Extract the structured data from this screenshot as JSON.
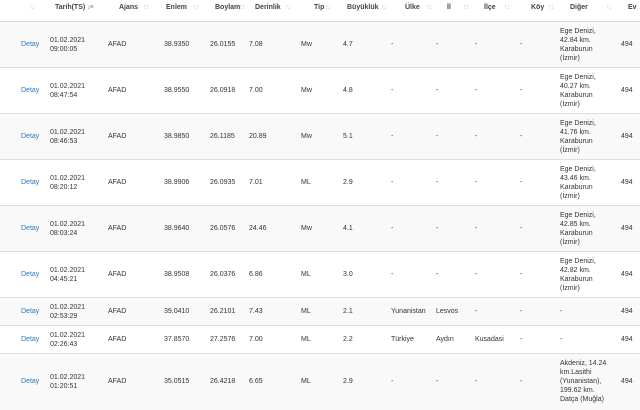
{
  "columns": [
    {
      "label": ""
    },
    {
      "label": "Tarih(TS)"
    },
    {
      "label": "Ajans"
    },
    {
      "label": "Enlem"
    },
    {
      "label": "Boylam"
    },
    {
      "label": "Derinlik"
    },
    {
      "label": "Tip"
    },
    {
      "label": "Büyüklük"
    },
    {
      "label": "Ülke"
    },
    {
      "label": "İl"
    },
    {
      "label": "İlçe"
    },
    {
      "label": "Köy"
    },
    {
      "label": "Diğer"
    },
    {
      "label": "Ev"
    }
  ],
  "rows": [
    {
      "action": "Detay",
      "date": "01.02.2021",
      "time": "09:00:05",
      "agency": "AFAD",
      "lat": "38.9350",
      "lon": "26.0155",
      "depth": "7.08",
      "type": "Mw",
      "mag": "4.7",
      "country": "-",
      "province": "-",
      "district": "-",
      "village": "-",
      "other": [
        "Ege Denizi,",
        "42.84 km.",
        "Karaburun",
        "(İzmir)"
      ],
      "event": "494"
    },
    {
      "action": "Detay",
      "date": "01.02.2021",
      "time": "08:47:54",
      "agency": "AFAD",
      "lat": "38.9550",
      "lon": "26.0918",
      "depth": "7.00",
      "type": "Mw",
      "mag": "4.8",
      "country": "-",
      "province": "-",
      "district": "-",
      "village": "-",
      "other": [
        "Ege Denizi,",
        "40.27 km.",
        "Karaburun",
        "(İzmir)"
      ],
      "event": "494"
    },
    {
      "action": "Detay",
      "date": "01.02.2021",
      "time": "08:46:53",
      "agency": "AFAD",
      "lat": "38.9850",
      "lon": "26.1185",
      "depth": "20.89",
      "type": "Mw",
      "mag": "5.1",
      "country": "-",
      "province": "-",
      "district": "-",
      "village": "-",
      "other": [
        "Ege Denizi,",
        "41.76 km.",
        "Karaburun",
        "(İzmir)"
      ],
      "event": "494"
    },
    {
      "action": "Detay",
      "date": "01.02.2021",
      "time": "08:20:12",
      "agency": "AFAD",
      "lat": "38.9906",
      "lon": "26.0935",
      "depth": "7.01",
      "type": "ML",
      "mag": "2.9",
      "country": "-",
      "province": "-",
      "district": "-",
      "village": "-",
      "other": [
        "Ege Denizi,",
        "43.46 km.",
        "Karaburun",
        "(İzmir)"
      ],
      "event": "494"
    },
    {
      "action": "Detay",
      "date": "01.02.2021",
      "time": "08:03:24",
      "agency": "AFAD",
      "lat": "38.9640",
      "lon": "26.0576",
      "depth": "24.46",
      "type": "Mw",
      "mag": "4.1",
      "country": "-",
      "province": "-",
      "district": "-",
      "village": "-",
      "other": [
        "Ege Denizi,",
        "42.85 km.",
        "Karaburun",
        "(İzmir)"
      ],
      "event": "494"
    },
    {
      "action": "Detay",
      "date": "01.02.2021",
      "time": "04:45:21",
      "agency": "AFAD",
      "lat": "38.9508",
      "lon": "26.0376",
      "depth": "6.86",
      "type": "ML",
      "mag": "3.0",
      "country": "-",
      "province": "-",
      "district": "-",
      "village": "-",
      "other": [
        "Ege Denizi,",
        "42.82 km.",
        "Karaburun",
        "(İzmir)"
      ],
      "event": "494"
    },
    {
      "action": "Detay",
      "date": "01.02.2021",
      "time": "02:53:29",
      "agency": "AFAD",
      "lat": "39.0410",
      "lon": "26.2101",
      "depth": "7.43",
      "type": "ML",
      "mag": "2.1",
      "country": "Yunanistan",
      "province": "Lesvos",
      "district": "-",
      "village": "-",
      "other": [
        "-"
      ],
      "event": "494"
    },
    {
      "action": "Detay",
      "date": "01.02.2021",
      "time": "02:26:43",
      "agency": "AFAD",
      "lat": "37.8570",
      "lon": "27.2576",
      "depth": "7.00",
      "type": "ML",
      "mag": "2.2",
      "country": "Türkiye",
      "province": "Aydın",
      "district": "Kusadasi",
      "village": "-",
      "other": [
        "-"
      ],
      "event": "494"
    },
    {
      "action": "Detay",
      "date": "01.02.2021",
      "time": "01:20:51",
      "agency": "AFAD",
      "lat": "35.0515",
      "lon": "26.4218",
      "depth": "6.65",
      "type": "ML",
      "mag": "2.9",
      "country": "-",
      "province": "-",
      "district": "-",
      "village": "-",
      "other": [
        "Akdeniz, 14.24",
        "km.Lasithi",
        "(Yunanistan),",
        "199.62 km.",
        "Datça (Muğla)"
      ],
      "event": "494"
    }
  ]
}
